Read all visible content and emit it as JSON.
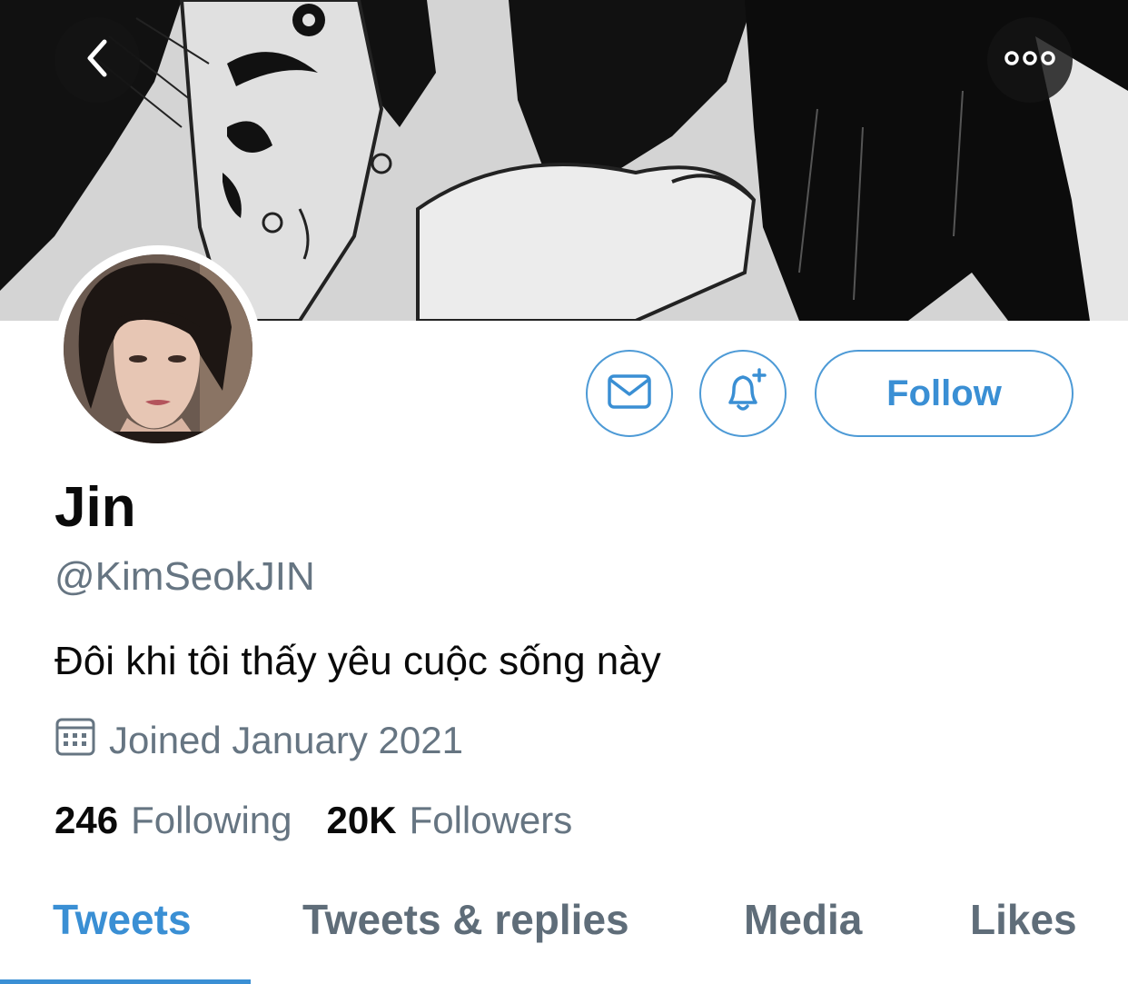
{
  "header": {
    "back_icon": "chevron-left-icon",
    "more_icon": "more-horizontal-icon",
    "banner_description_icon": "manga-banner-image"
  },
  "profile": {
    "name": "Jin",
    "handle": "@KimSeokJIN",
    "bio": "Đôi khi tôi thấy yêu cuộc sống này",
    "joined": "Joined January 2021",
    "avatar_icon": "profile-photo"
  },
  "actions": {
    "message_icon": "envelope-icon",
    "notify_icon": "bell-plus-icon",
    "follow_label": "Follow"
  },
  "stats": {
    "following_count": "246",
    "following_label": "Following",
    "followers_count": "20K",
    "followers_label": "Followers"
  },
  "tabs": [
    {
      "label": "Tweets",
      "active": true
    },
    {
      "label": "Tweets & replies",
      "active": false
    },
    {
      "label": "Media",
      "active": false
    },
    {
      "label": "Likes",
      "active": false
    }
  ],
  "colors": {
    "accent": "#3a8fd4",
    "secondary_text": "#667582",
    "primary_text": "#0a0a0a"
  }
}
